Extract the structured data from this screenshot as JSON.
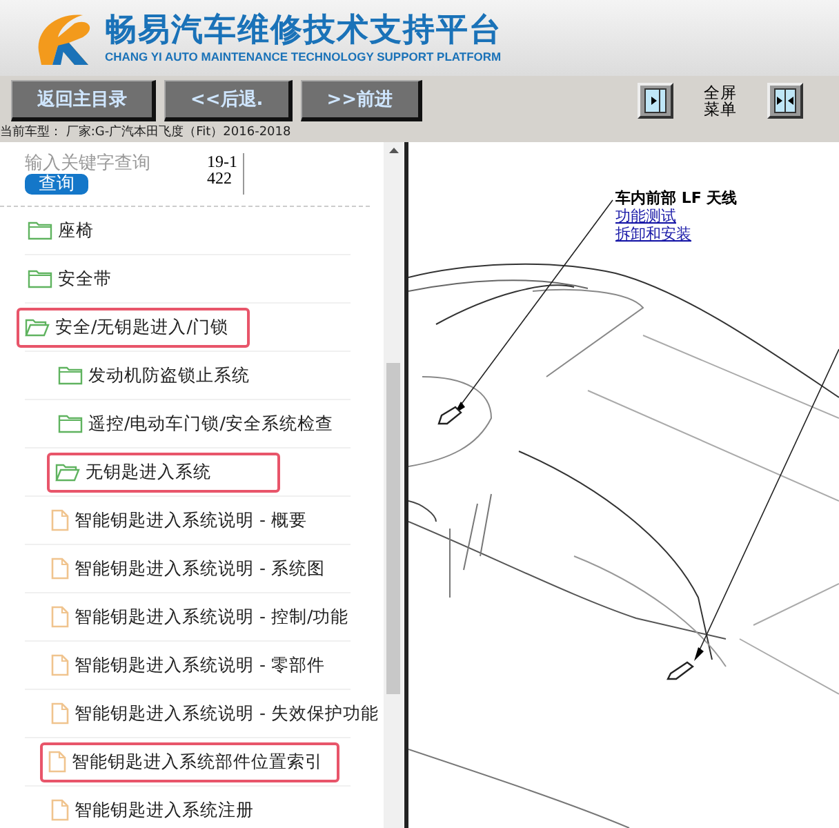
{
  "header": {
    "title": "畅易汽车维修技术支持平台",
    "subtitle": "CHANG YI AUTO MAINTENANCE TECHNOLOGY SUPPORT PLATFORM"
  },
  "toolbar": {
    "buttons": [
      "返回主目录",
      "<<后退.",
      ">>前进"
    ],
    "fullscreen_menu": [
      "全屏",
      "菜单"
    ]
  },
  "current_model": "当前车型： 厂家:G-广汽本田飞度（Fit）2016-2018",
  "search": {
    "placeholder": "输入关键字查询",
    "button": "查询",
    "code": "19-1422"
  },
  "tree": [
    {
      "kind": "folder",
      "label": "座椅",
      "expanded": false,
      "highlighted": false
    },
    {
      "kind": "folder",
      "label": "安全带",
      "expanded": false,
      "highlighted": false
    },
    {
      "kind": "folder",
      "label": "安全/无钥匙进入/门锁",
      "expanded": true,
      "highlighted": true,
      "children": [
        {
          "kind": "folder",
          "label": "发动机防盗锁止系统",
          "expanded": false,
          "highlighted": false
        },
        {
          "kind": "folder",
          "label": "遥控/电动车门锁/安全系统检查",
          "expanded": false,
          "highlighted": false
        },
        {
          "kind": "folder",
          "label": "无钥匙进入系统",
          "expanded": true,
          "highlighted": true,
          "children": [
            {
              "kind": "document",
              "label": "智能钥匙进入系统说明 - 概要",
              "highlighted": false
            },
            {
              "kind": "document",
              "label": "智能钥匙进入系统说明 - 系统图",
              "highlighted": false
            },
            {
              "kind": "document",
              "label": "智能钥匙进入系统说明 - 控制/功能",
              "highlighted": false
            },
            {
              "kind": "document",
              "label": "智能钥匙进入系统说明 - 零部件",
              "highlighted": false
            },
            {
              "kind": "document",
              "label": "智能钥匙进入系统说明 - 失效保护功能",
              "highlighted": false
            },
            {
              "kind": "document",
              "label": "智能钥匙进入系统部件位置索引",
              "highlighted": true
            },
            {
              "kind": "document",
              "label": "智能钥匙进入系统注册",
              "highlighted": false
            }
          ]
        }
      ]
    }
  ],
  "diagram": {
    "callout": "车内前部 LF 天线",
    "links": [
      "功能测试",
      "拆卸和安装"
    ]
  }
}
